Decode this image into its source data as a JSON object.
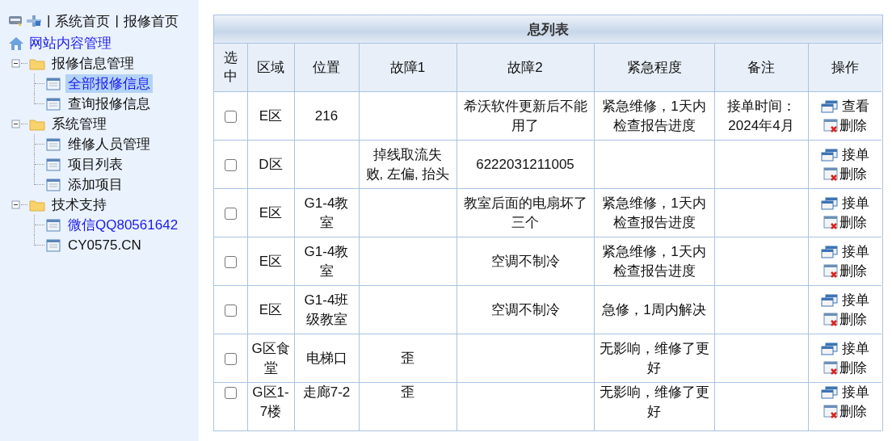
{
  "sidebar": {
    "separator": "|",
    "links": [
      {
        "label": "系统首页"
      },
      {
        "label": "报修首页"
      }
    ],
    "tree": {
      "label": "网站内容管理",
      "children": [
        {
          "label": "报修信息管理",
          "expanded": true,
          "children": [
            {
              "label": "全部报修信息",
              "selected": true,
              "link": true
            },
            {
              "label": "查询报修信息",
              "selected": false,
              "link": false
            }
          ]
        },
        {
          "label": "系统管理",
          "expanded": true,
          "children": [
            {
              "label": "维修人员管理",
              "selected": false,
              "link": false
            },
            {
              "label": "项目列表",
              "selected": false,
              "link": false
            },
            {
              "label": "添加项目",
              "selected": false,
              "link": false
            }
          ]
        },
        {
          "label": "技术支持",
          "expanded": true,
          "children": [
            {
              "label": "微信QQ80561642",
              "selected": false,
              "link": true
            },
            {
              "label": "CY0575.CN",
              "selected": false,
              "link": false
            }
          ]
        }
      ]
    }
  },
  "table": {
    "title": "息列表",
    "columns": [
      "选中",
      "区域",
      "位置",
      "故障1",
      "故障2",
      "紧急程度",
      "备注",
      "操作"
    ],
    "rows": [
      {
        "checked": false,
        "area": "E区",
        "location": "216",
        "fault1": "",
        "fault2": "希沃软件更新后不能用了",
        "urgency": "紧急维修，1天内检查报告进度",
        "note": "接单时间：2024年4月",
        "actions": [
          {
            "kind": "view",
            "label": "查看"
          },
          {
            "kind": "delete",
            "label": "删除"
          }
        ]
      },
      {
        "checked": false,
        "area": "D区",
        "location": "",
        "fault1": "掉线取流失败, 左偏, 抬头",
        "fault2": "6222031211005",
        "urgency": "",
        "note": "",
        "actions": [
          {
            "kind": "view",
            "label": "接单"
          },
          {
            "kind": "delete",
            "label": "删除"
          }
        ]
      },
      {
        "checked": false,
        "area": "E区",
        "location": "G1-4教室",
        "fault1": "",
        "fault2": "教室后面的电扇坏了三个",
        "urgency": "紧急维修，1天内检查报告进度",
        "note": "",
        "actions": [
          {
            "kind": "view",
            "label": "接单"
          },
          {
            "kind": "delete",
            "label": "删除"
          }
        ]
      },
      {
        "checked": false,
        "area": "E区",
        "location": "G1-4教室",
        "fault1": "",
        "fault2": "空调不制冷",
        "urgency": "紧急维修，1天内检查报告进度",
        "note": "",
        "actions": [
          {
            "kind": "view",
            "label": "接单"
          },
          {
            "kind": "delete",
            "label": "删除"
          }
        ]
      },
      {
        "checked": false,
        "area": "E区",
        "location": "G1-4班级教室",
        "fault1": "",
        "fault2": "空调不制冷",
        "urgency": "急修，1周内解决",
        "note": "",
        "actions": [
          {
            "kind": "view",
            "label": "接单"
          },
          {
            "kind": "delete",
            "label": "删除"
          }
        ]
      },
      {
        "checked": false,
        "area": "G区食堂",
        "location": "电梯口",
        "fault1": "歪",
        "fault2": "",
        "urgency": "无影响，维修了更好",
        "note": "",
        "actions": [
          {
            "kind": "view",
            "label": "接单"
          },
          {
            "kind": "delete",
            "label": "删除"
          }
        ]
      },
      {
        "checked": false,
        "area": "G区1-7楼",
        "location": "走廊7-2",
        "fault1": "歪",
        "fault2": "",
        "urgency": "无影响，维修了更好",
        "note": "",
        "actions": [
          {
            "kind": "view",
            "label": "接单"
          },
          {
            "kind": "delete",
            "label": "删除"
          }
        ]
      }
    ]
  }
}
